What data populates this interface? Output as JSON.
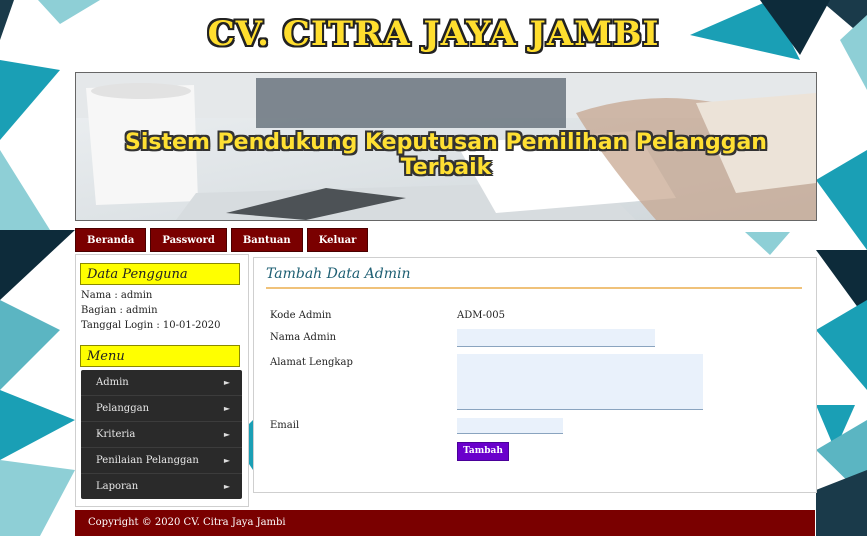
{
  "site": {
    "title": "CV. CITRA JAYA JAMBI"
  },
  "banner": {
    "title": "Sistem Pendukung Keputusan Pemilihan Pelanggan Terbaik"
  },
  "nav": [
    "Beranda",
    "Password",
    "Bantuan",
    "Keluar"
  ],
  "sidebar": {
    "user_heading": "Data Pengguna",
    "user_info": [
      "Nama : admin",
      "Bagian : admin",
      "Tanggal Login : 10-01-2020"
    ],
    "menu_heading": "Menu",
    "menu": [
      "Admin",
      "Pelanggan",
      "Kriteria",
      "Penilaian Pelanggan",
      "Laporan"
    ]
  },
  "form": {
    "title": "Tambah Data Admin",
    "kode_label": "Kode Admin",
    "kode_value": "ADM-005",
    "nama_label": "Nama Admin",
    "nama_value": "",
    "alamat_label": "Alamat Lengkap",
    "alamat_value": "",
    "email_label": "Email",
    "email_value": "",
    "submit": "Tambah"
  },
  "footer": {
    "text": "Copyright © 2020 CV. Citra Jaya Jambi"
  },
  "colors": {
    "nav_bg": "#7a0000",
    "heading_bg": "#ffff00",
    "button_bg": "#6a00cc",
    "accent_teal": "#1a9fb5"
  },
  "icons": {
    "menu_chevron": "chevron-right-icon"
  }
}
